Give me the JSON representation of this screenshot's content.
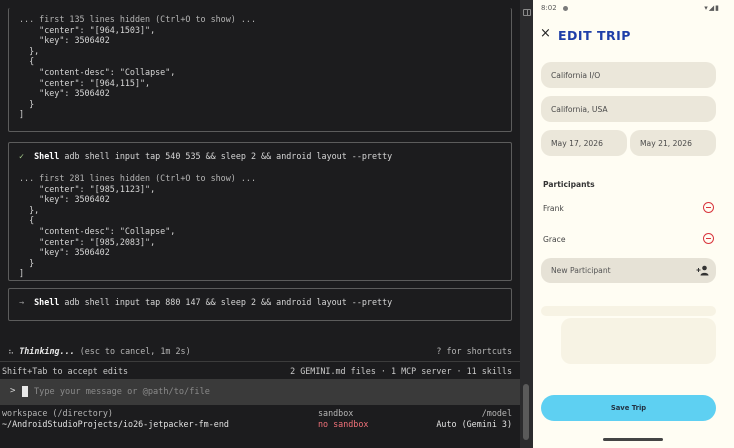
{
  "terminal": {
    "block1": {
      "lines": [
        "... first 135 lines hidden (Ctrl+O to show) ...",
        "    \"center\": \"[964,1503]\",",
        "    \"key\": 3506402",
        "  },",
        "  {",
        "    \"content-desc\": \"Collapse\",",
        "    \"center\": \"[964,115]\",",
        "    \"key\": 3506402",
        "  }",
        "]"
      ]
    },
    "block2": {
      "status_icon": "✓",
      "tool": "Shell",
      "command": "adb shell input tap 540 535 && sleep 2 && android layout --pretty",
      "lines": [
        "... first 281 lines hidden (Ctrl+O to show) ...",
        "    \"center\": \"[985,1123]\",",
        "    \"key\": 3506402",
        "  },",
        "  {",
        "    \"content-desc\": \"Collapse\",",
        "    \"center\": \"[985,2083]\",",
        "    \"key\": 3506402",
        "  }",
        "]"
      ]
    },
    "block3": {
      "status_icon": "→",
      "tool": "Shell",
      "command": "adb shell input tap 880 147 && sleep 2 && android layout --pretty"
    },
    "thinking": {
      "spinner": "⠦",
      "label": "Thinking...",
      "detail": "(esc to cancel, 1m 2s)",
      "shortcuts": "? for shortcuts"
    },
    "accept_hint": "Shift+Tab to accept edits",
    "context_summary": "2 GEMINI.md files · 1 MCP server · 11 skills",
    "input": {
      "prompt": ">",
      "placeholder": "Type your message or @path/to/file"
    },
    "footer": {
      "workspace_label": "workspace (/directory)",
      "workspace_value": "~/AndroidStudioProjects/io26-jetpacker-fm-end",
      "sandbox_label": "sandbox",
      "sandbox_value": "no sandbox",
      "model_label": "/model",
      "model_value": "Auto (Gemini 3)"
    }
  },
  "phone": {
    "status": {
      "time": "8:02",
      "sys_icons": "▾◢▮"
    },
    "title": "EDIT TRIP",
    "close_icon": "×",
    "trip_name": "California I/O",
    "location": "California, USA",
    "start_date": "May 17, 2026",
    "end_date": "May 21, 2026",
    "participants_title": "Participants",
    "participants": [
      "Frank",
      "Grace"
    ],
    "new_participant_placeholder": "New Participant",
    "save_label": "Save Trip"
  },
  "colors": {
    "accent_title": "#1f3fa8",
    "save_button": "#5ed0f2",
    "remove_icon": "#d9363e",
    "sandbox_warning": "#f07178",
    "check": "#a8d08d"
  }
}
